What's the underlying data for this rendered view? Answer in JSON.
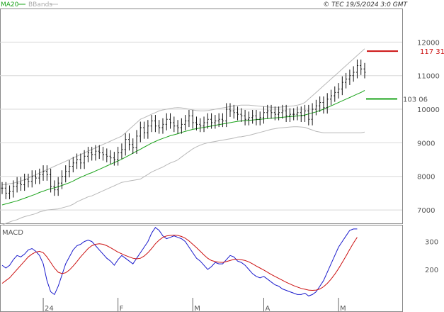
{
  "credit": "© TEC 19/5/2024 3:0 GMT",
  "legend": [
    {
      "label": "MA20",
      "color": "#1aa31a"
    },
    {
      "label": "BBands",
      "color": "#b0b0b0"
    }
  ],
  "colors": {
    "ma20": "#1aa31a",
    "bbands": "#b8b8b8",
    "price": "#111111",
    "macd": "#1a1acc",
    "signal": "#cc1111",
    "target": "#cc1111",
    "support": "#1aa31a"
  },
  "chart_data": [
    {
      "type": "candlestick",
      "title": "",
      "y_ticks": [
        7000,
        8000,
        9000,
        10000,
        11000,
        12000
      ],
      "ylim": [
        6600,
        13000
      ],
      "x_ticks": [
        {
          "label": "24",
          "index": 11
        },
        {
          "label": "F",
          "index": 31
        },
        {
          "label": "M",
          "index": 51
        },
        {
          "label": "A",
          "index": 70
        },
        {
          "label": "M",
          "index": 90
        }
      ],
      "close": [
        7650,
        7500,
        7550,
        7700,
        7800,
        7750,
        7900,
        7850,
        8000,
        7950,
        8050,
        8150,
        8050,
        7700,
        7600,
        7800,
        8000,
        8150,
        8300,
        8400,
        8500,
        8400,
        8600,
        8700,
        8650,
        8750,
        8700,
        8650,
        8600,
        8550,
        8500,
        8700,
        8800,
        9100,
        8950,
        8850,
        9200,
        9450,
        9300,
        9500,
        9650,
        9500,
        9450,
        9550,
        9700,
        9600,
        9500,
        9450,
        9550,
        9650,
        9800,
        9600,
        9550,
        9500,
        9600,
        9700,
        9600,
        9650,
        9700,
        9650,
        10000,
        9950,
        9900,
        9850,
        9800,
        9700,
        9750,
        9800,
        9700,
        9750,
        9900,
        9950,
        9900,
        9850,
        9900,
        9950,
        9800,
        9850,
        9850,
        9900,
        9800,
        9950,
        9700,
        10000,
        10100,
        10200,
        10050,
        10300,
        10400,
        10500,
        10600,
        10800,
        10900,
        11000,
        11100,
        11300,
        11200,
        11100
      ],
      "ma20": [
        7150,
        7180,
        7210,
        7240,
        7270,
        7310,
        7350,
        7390,
        7430,
        7470,
        7520,
        7560,
        7600,
        7630,
        7660,
        7690,
        7730,
        7770,
        7810,
        7860,
        7920,
        7970,
        8020,
        8070,
        8110,
        8160,
        8210,
        8260,
        8310,
        8360,
        8410,
        8460,
        8510,
        8570,
        8630,
        8690,
        8750,
        8810,
        8870,
        8930,
        8990,
        9040,
        9090,
        9130,
        9170,
        9210,
        9240,
        9270,
        9310,
        9340,
        9370,
        9400,
        9420,
        9440,
        9460,
        9480,
        9500,
        9520,
        9540,
        9560,
        9580,
        9600,
        9620,
        9640,
        9650,
        9660,
        9670,
        9680,
        9690,
        9700,
        9710,
        9720,
        9730,
        9740,
        9750,
        9760,
        9770,
        9780,
        9790,
        9800,
        9810,
        9830,
        9860,
        9890,
        9920,
        9960,
        10000,
        10050,
        10100,
        10150,
        10200,
        10250,
        10300,
        10350,
        10400,
        10450,
        10500,
        10560
      ],
      "bb_upper": [
        7750,
        7760,
        7780,
        7800,
        7830,
        7860,
        7900,
        7950,
        8000,
        8050,
        8100,
        8150,
        8200,
        8250,
        8300,
        8350,
        8400,
        8450,
        8500,
        8550,
        8600,
        8650,
        8700,
        8750,
        8800,
        8850,
        8900,
        8950,
        9000,
        9050,
        9100,
        9150,
        9200,
        9300,
        9400,
        9500,
        9600,
        9700,
        9750,
        9800,
        9850,
        9900,
        9950,
        9980,
        10000,
        10020,
        10040,
        10050,
        10040,
        10020,
        10000,
        9980,
        9960,
        9950,
        9950,
        9960,
        9980,
        10000,
        10020,
        10040,
        10060,
        10080,
        10100,
        10110,
        10120,
        10120,
        10120,
        10110,
        10100,
        10090,
        10080,
        10070,
        10060,
        10060,
        10060,
        10070,
        10080,
        10090,
        10100,
        10120,
        10150,
        10200,
        10300,
        10400,
        10500,
        10600,
        10700,
        10800,
        10900,
        11000,
        11100,
        11200,
        11300,
        11400,
        11500,
        11600,
        11700,
        11800
      ],
      "bb_lower": [
        6550,
        6600,
        6640,
        6680,
        6710,
        6760,
        6800,
        6830,
        6860,
        6890,
        6940,
        6970,
        7000,
        7010,
        7020,
        7030,
        7060,
        7090,
        7120,
        7170,
        7240,
        7290,
        7340,
        7390,
        7420,
        7470,
        7520,
        7570,
        7620,
        7670,
        7720,
        7770,
        7820,
        7840,
        7860,
        7880,
        7900,
        7920,
        7990,
        8060,
        8130,
        8180,
        8230,
        8280,
        8340,
        8400,
        8440,
        8490,
        8580,
        8660,
        8740,
        8820,
        8880,
        8930,
        8970,
        9000,
        9020,
        9040,
        9060,
        9080,
        9100,
        9120,
        9140,
        9170,
        9180,
        9200,
        9220,
        9250,
        9280,
        9310,
        9340,
        9370,
        9400,
        9420,
        9440,
        9450,
        9460,
        9470,
        9480,
        9480,
        9470,
        9460,
        9420,
        9380,
        9340,
        9320,
        9300,
        9300,
        9300,
        9300,
        9300,
        9300,
        9300,
        9300,
        9300,
        9300,
        9300,
        9320
      ],
      "levels": [
        {
          "label": "117 31",
          "value": 11731,
          "color": "#cc1111"
        },
        {
          "label": "103 06",
          "value": 10306,
          "color": "#1aa31a"
        }
      ]
    },
    {
      "type": "line",
      "title": "MACD",
      "y_ticks": [
        200,
        300
      ],
      "ylim": [
        50,
        360
      ],
      "series": [
        {
          "name": "",
          "values": [
            215,
            205,
            215,
            235,
            250,
            245,
            255,
            270,
            275,
            265,
            250,
            220,
            160,
            120,
            110,
            140,
            180,
            220,
            245,
            270,
            285,
            290,
            300,
            305,
            300,
            285,
            270,
            255,
            240,
            230,
            215,
            235,
            250,
            240,
            230,
            220,
            240,
            260,
            280,
            300,
            330,
            350,
            340,
            320,
            310,
            315,
            320,
            315,
            310,
            300,
            280,
            260,
            240,
            230,
            215,
            200,
            210,
            225,
            220,
            220,
            235,
            250,
            245,
            230,
            225,
            215,
            200,
            185,
            175,
            170,
            175,
            165,
            155,
            145,
            140,
            130,
            125,
            120,
            115,
            110,
            110,
            115,
            105,
            110,
            120,
            140,
            160,
            190,
            220,
            250,
            280,
            300,
            320,
            340,
            345,
            345
          ]
        },
        {
          "name": "",
          "values": [
            150,
            160,
            170,
            185,
            200,
            215,
            230,
            245,
            255,
            262,
            265,
            260,
            245,
            225,
            205,
            190,
            185,
            188,
            198,
            212,
            228,
            245,
            260,
            275,
            285,
            290,
            292,
            290,
            285,
            278,
            270,
            262,
            256,
            250,
            245,
            240,
            238,
            240,
            248,
            260,
            275,
            292,
            305,
            315,
            320,
            322,
            323,
            322,
            318,
            312,
            302,
            290,
            278,
            265,
            252,
            240,
            232,
            228,
            226,
            225,
            228,
            232,
            236,
            236,
            235,
            232,
            227,
            220,
            212,
            205,
            198,
            190,
            182,
            175,
            168,
            161,
            154,
            148,
            142,
            137,
            132,
            129,
            126,
            125,
            126,
            130,
            138,
            150,
            165,
            183,
            203,
            225,
            248,
            272,
            295,
            315
          ]
        }
      ]
    }
  ]
}
